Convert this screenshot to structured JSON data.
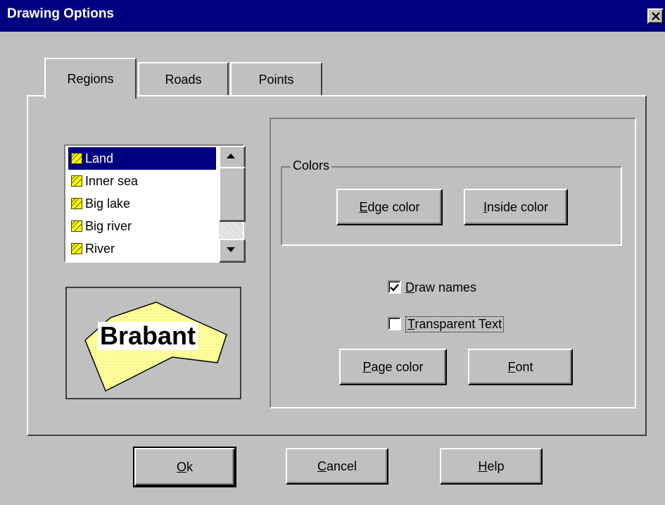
{
  "window": {
    "title": "Drawing Options"
  },
  "tabs": [
    {
      "label": "Regions",
      "active": true
    },
    {
      "label": "Roads",
      "active": false
    },
    {
      "label": "Points",
      "active": false
    }
  ],
  "region_list": {
    "items": [
      "Land",
      "Inner sea",
      "Big lake",
      "Big river",
      "River"
    ],
    "selected": "Land"
  },
  "preview": {
    "label": "Brabant"
  },
  "colors_group": {
    "legend": "Colors",
    "edge_button": {
      "mnemonic": "E",
      "rest": "dge color"
    },
    "inside_button": {
      "mnemonic": "I",
      "rest": "nside color"
    }
  },
  "options": {
    "draw_names": {
      "mnemonic": "D",
      "rest": "raw names",
      "checked": true
    },
    "transparent_text": {
      "mnemonic": "T",
      "rest": "ransparent Text",
      "checked": false
    }
  },
  "page_color_button": {
    "mnemonic": "P",
    "rest": "age color"
  },
  "font_button": {
    "mnemonic": "F",
    "rest": "ont"
  },
  "footer": {
    "ok": {
      "mnemonic": "O",
      "rest": "k"
    },
    "cancel": {
      "mnemonic": "C",
      "rest": "ancel"
    },
    "help": {
      "mnemonic": "H",
      "rest": "elp"
    }
  },
  "colors": {
    "title_bar": "#000080",
    "face": "#c0c0c0",
    "selection": "#000080",
    "shape_fill": "#ffff99"
  }
}
